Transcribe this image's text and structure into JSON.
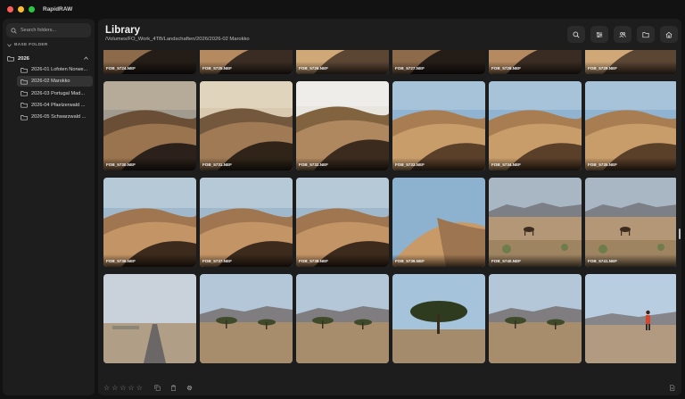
{
  "app": {
    "title": "RapidRAW"
  },
  "window_controls": {
    "close_color": "#ff5f57",
    "minimize_color": "#febc2e",
    "maximize_color": "#28c840"
  },
  "sidebar": {
    "search_placeholder": "Search folders...",
    "section_title": "BASE FOLDER",
    "root": {
      "label": "2026",
      "expanded": true
    },
    "folders": [
      {
        "label": "2026-01 Lofoten Norwe...",
        "selected": false
      },
      {
        "label": "2026-02 Marokko",
        "selected": true
      },
      {
        "label": "2026-03 Portugal Mad...",
        "selected": false
      },
      {
        "label": "2026-04 Pfaelzerwald ...",
        "selected": false
      },
      {
        "label": "2026-05 Schwarzwald ...",
        "selected": false
      }
    ]
  },
  "header": {
    "title": "Library",
    "path": "/Volumes/FO_Work_4TB/Landschaften/2026/2026-02 Marokko",
    "toolbar_icons": [
      "search-icon",
      "filter-icon",
      "people-icon",
      "folder-icon",
      "home-icon"
    ]
  },
  "thumbnails": [
    {
      "file": "FOB_5724.NEF",
      "scene": "dune-dusk-dark"
    },
    {
      "file": "FOB_5725.NEF",
      "scene": "dune-dusk"
    },
    {
      "file": "FOB_5726.NEF",
      "scene": "dune-dusk-light"
    },
    {
      "file": "FOB_5727.NEF",
      "scene": "dune-dusk-dark"
    },
    {
      "file": "FOB_5728.NEF",
      "scene": "dune-dusk"
    },
    {
      "file": "FOB_5729.NEF",
      "scene": "dune-dusk-light"
    },
    {
      "file": "FOB_5730.NEF",
      "scene": "dune-ridge-dark"
    },
    {
      "file": "FOB_5731.NEF",
      "scene": "dune-ridge"
    },
    {
      "file": "FOB_5732.NEF",
      "scene": "dune-ridge-bright"
    },
    {
      "file": "FOB_5733.NEF",
      "scene": "dune-blue"
    },
    {
      "file": "FOB_5734.NEF",
      "scene": "dune-blue"
    },
    {
      "file": "FOB_5735.NEF",
      "scene": "dune-blue"
    },
    {
      "file": "FOB_5736.NEF",
      "scene": "dune-warm"
    },
    {
      "file": "FOB_5737.NEF",
      "scene": "dune-warm"
    },
    {
      "file": "FOB_5738.NEF",
      "scene": "dune-warm"
    },
    {
      "file": "FOB_5739.NEF",
      "scene": "dune-single"
    },
    {
      "file": "FOB_5740.NEF",
      "scene": "desert-camel"
    },
    {
      "file": "FOB_5741.NEF",
      "scene": "desert-camel"
    },
    {
      "file": "",
      "scene": "desert-road"
    },
    {
      "file": "",
      "scene": "desert-trees"
    },
    {
      "file": "",
      "scene": "desert-trees"
    },
    {
      "file": "",
      "scene": "acacia"
    },
    {
      "file": "",
      "scene": "desert-trees"
    },
    {
      "file": "",
      "scene": "desert-person"
    }
  ],
  "statusbar": {
    "rating_stars": 5,
    "rating_value": 0,
    "icons": [
      "copy-icon",
      "paste-icon",
      "settings-icon",
      "document-icon"
    ]
  },
  "colors": {
    "background": "#121212",
    "panel": "#1d1d1d",
    "selected": "#333333",
    "button": "#2b2b2b"
  }
}
